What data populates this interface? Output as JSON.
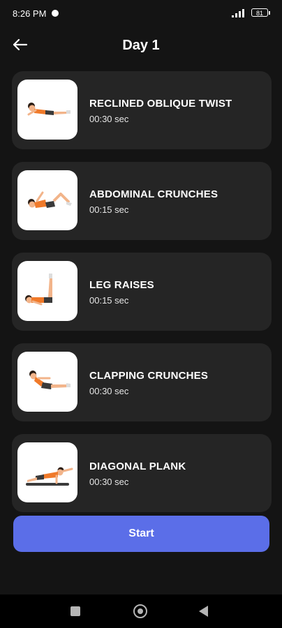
{
  "status": {
    "time": "8:26 PM",
    "battery": "81"
  },
  "header": {
    "title": "Day 1",
    "back_icon": "arrow-left-icon"
  },
  "exercises": [
    {
      "name": "RECLINED OBLIQUE TWIST",
      "duration": "00:30 sec"
    },
    {
      "name": "ABDOMINAL CRUNCHES",
      "duration": "00:15 sec"
    },
    {
      "name": "LEG RAISES",
      "duration": "00:15 sec"
    },
    {
      "name": "CLAPPING CRUNCHES",
      "duration": "00:30 sec"
    },
    {
      "name": "DIAGONAL PLANK",
      "duration": "00:30 sec"
    }
  ],
  "start_label": "Start",
  "colors": {
    "background": "#141414",
    "card": "#252525",
    "accent": "#5b6ee8"
  }
}
